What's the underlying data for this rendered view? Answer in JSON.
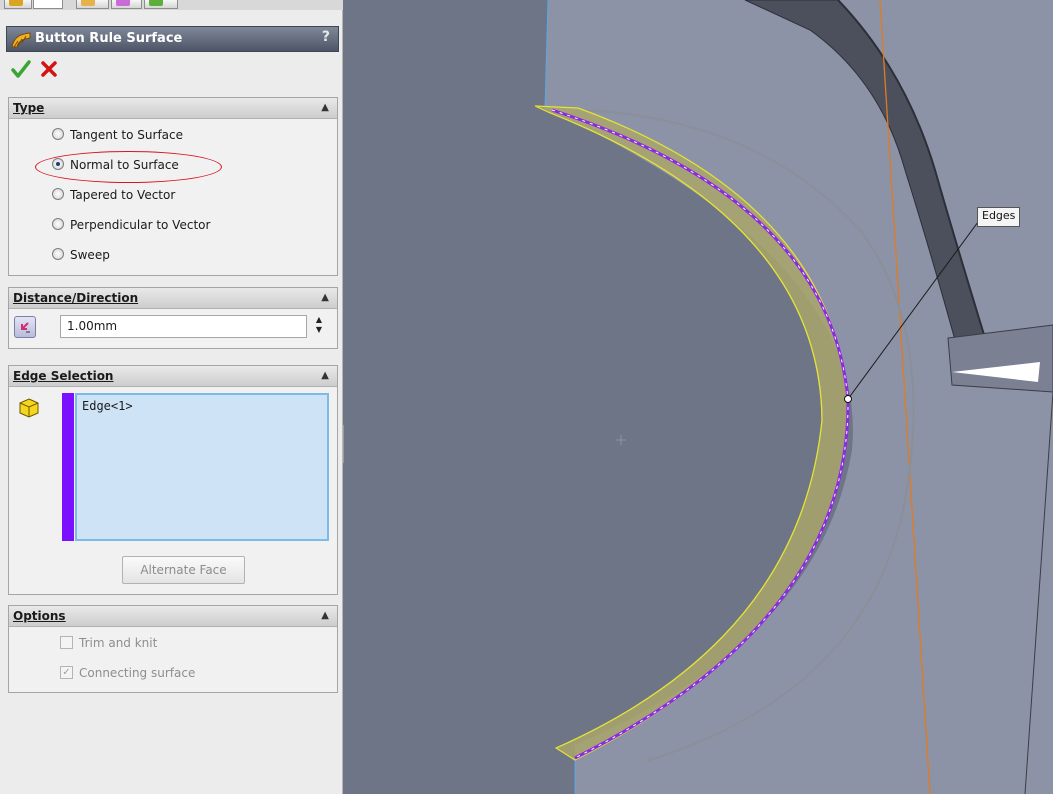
{
  "property_manager": {
    "title": "Button Rule Surface",
    "help": "?",
    "ok_icon": "checkmark-icon",
    "cancel_icon": "x-icon",
    "sections": {
      "type": {
        "header": "Type",
        "options": [
          {
            "label": "Tangent to Surface",
            "selected": false
          },
          {
            "label": "Normal to Surface",
            "selected": true
          },
          {
            "label": "Tapered to Vector",
            "selected": false
          },
          {
            "label": "Perpendicular to Vector",
            "selected": false
          },
          {
            "label": "Sweep",
            "selected": false
          }
        ]
      },
      "distance": {
        "header": "Distance/Direction",
        "value": "1.00mm"
      },
      "edge_selection": {
        "header": "Edge Selection",
        "items": [
          "Edge<1>"
        ],
        "list_color": "#7a10ff",
        "alternate_face": "Alternate Face"
      },
      "options": {
        "header": "Options",
        "trim_and_knit": {
          "label": "Trim and knit",
          "checked": false
        },
        "connecting_surface": {
          "label": "Connecting surface",
          "checked": true
        }
      }
    }
  },
  "viewport": {
    "callout": "Edges",
    "colors": {
      "background": "#6e7586",
      "light_face": "#8a90a3",
      "highlight": "#e2e23a",
      "selected_edge": "#8a2be2",
      "plane_line": "#e07b20"
    }
  }
}
